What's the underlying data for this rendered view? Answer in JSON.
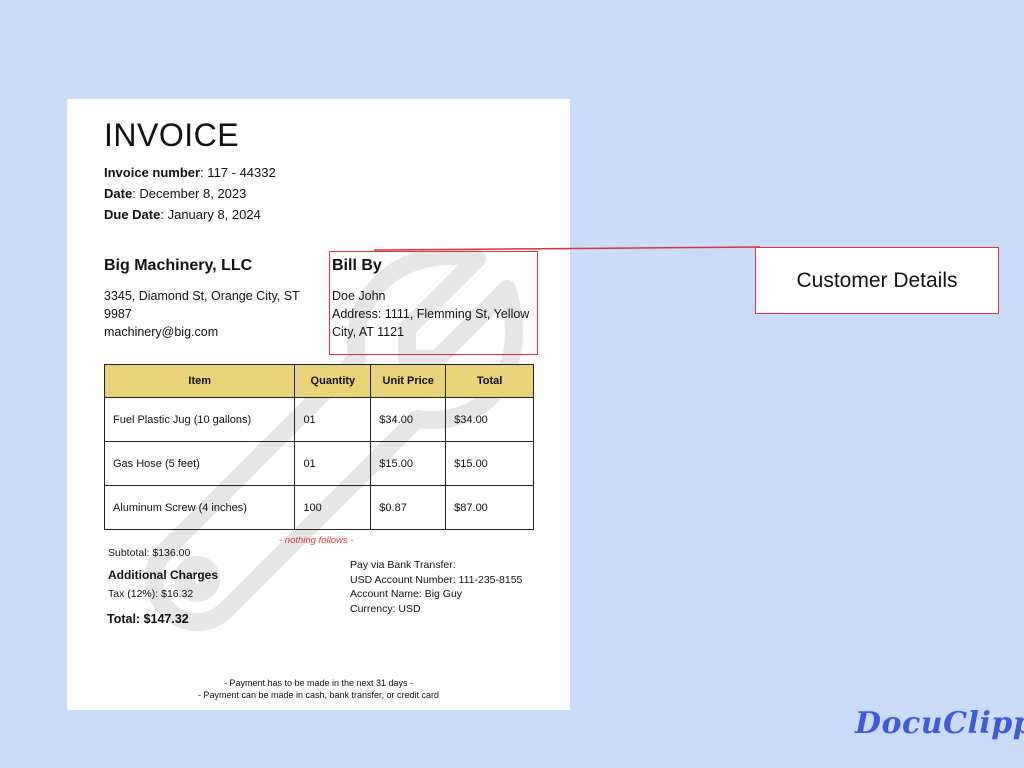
{
  "invoice": {
    "title": "INVOICE",
    "meta": [
      {
        "label": "Invoice number",
        "value": ": 117 - 44332"
      },
      {
        "label": "Date",
        "value": ": December 8, 2023"
      },
      {
        "label": "Due Date",
        "value": ": January 8, 2024"
      }
    ],
    "seller": {
      "name": "Big Machinery, LLC",
      "address": "3345, Diamond St, Orange City, ST 9987",
      "email": "machinery@big.com"
    },
    "bill_by": {
      "heading": "Bill By",
      "name": "Doe John",
      "address": "Address: 1111, Flemming St, Yellow City, AT 1121"
    },
    "table": {
      "headers": [
        "Item",
        "Quantity",
        "Unit Price",
        "Total"
      ],
      "rows": [
        [
          "Fuel Plastic Jug (10 gallons)",
          "01",
          "$34.00",
          "$34.00"
        ],
        [
          "Gas Hose (5 feet)",
          "01",
          "$15.00",
          "$15.00"
        ],
        [
          "Aluminum Screw (4 inches)",
          "100",
          "$0.87",
          "$87.00"
        ]
      ]
    },
    "nothing_follows": "- nothing follows -",
    "subtotal": "Subtotal: $136.00",
    "additional_charges": "Additional Charges",
    "tax": "Tax (12%): $16.32",
    "total": "Total: $147.32",
    "payment": [
      "Pay via Bank Transfer:",
      "USD Account Number: 111-235-8155",
      "Account Name: Big Guy",
      "Currency: USD"
    ],
    "footer": [
      "- Payment has to be made in the next 31 days -",
      "- Payment can be made in cash, bank transfer, or credit card"
    ],
    "watermark_icon": "wrench-icon"
  },
  "callout": {
    "label": "Customer Details",
    "color": "#e0313c"
  },
  "brand": {
    "logo": "DocuClipper",
    "color": "#3f5bd8"
  },
  "colors": {
    "background": "#c9dcfc",
    "table_header": "#e9d277"
  }
}
